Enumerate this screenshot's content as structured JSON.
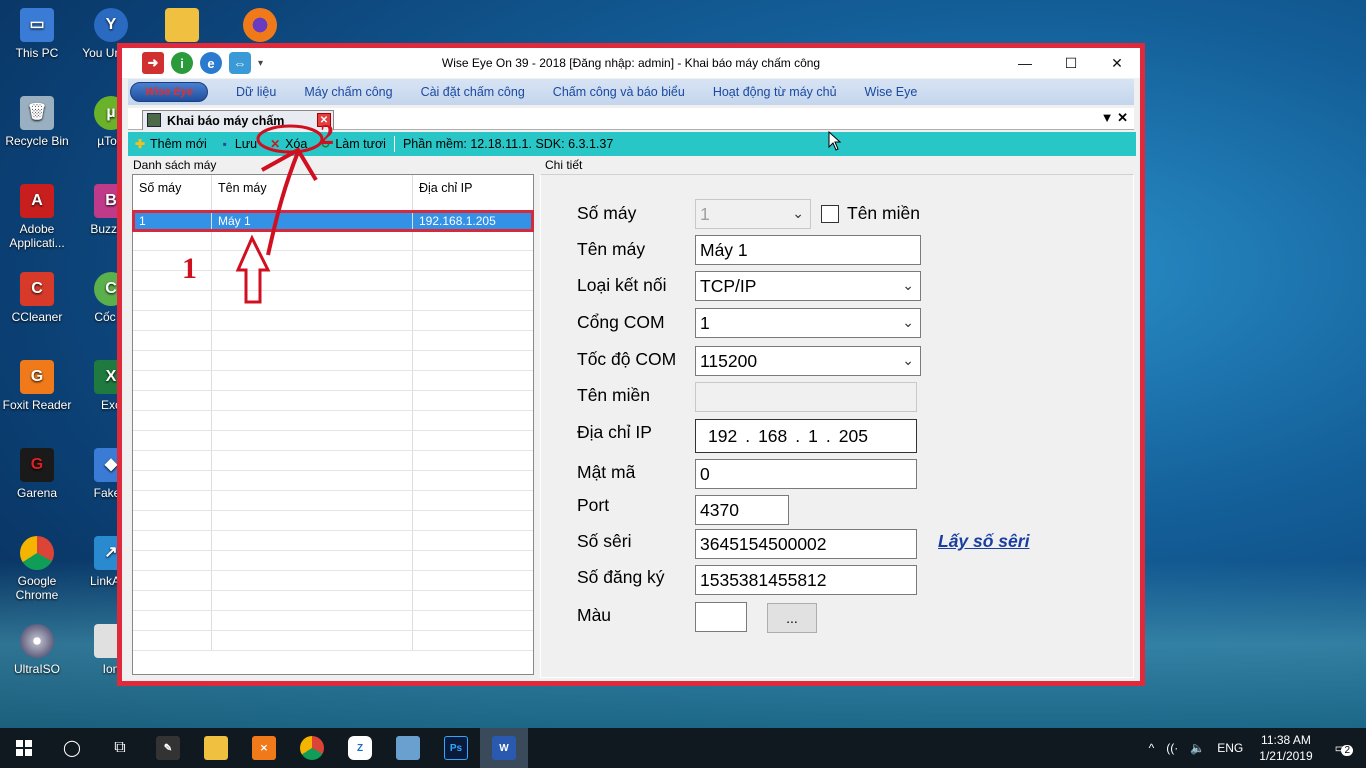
{
  "desktop": {
    "icons_left": [
      {
        "label": "This PC"
      },
      {
        "label": "Recycle Bin"
      },
      {
        "label": "Adobe Applicati..."
      },
      {
        "label": "CCleaner"
      },
      {
        "label": "Foxit Reader"
      },
      {
        "label": "Garena"
      },
      {
        "label": "Google Chrome"
      },
      {
        "label": "UltraISO"
      }
    ],
    "icons_second": [
      {
        "label": "You Uninst"
      },
      {
        "label": "µTorr"
      },
      {
        "label": "BuzzBu"
      },
      {
        "label": "Cốc C"
      },
      {
        "label": "Exc"
      },
      {
        "label": "FakeA"
      },
      {
        "label": "LinkAss"
      },
      {
        "label": "Ion"
      }
    ]
  },
  "window": {
    "title": "Wise Eye On 39 - 2018 [Đăng nhập: admin] - Khai báo máy chấm công",
    "logo_text": "Wise Eye",
    "menu": [
      "Dữ liệu",
      "Máy chấm công",
      "Cài đặt chấm công",
      "Chấm công và báo biểu",
      "Hoạt động từ máy chủ",
      "Wise Eye"
    ],
    "doc_tab": "Khai báo máy chấm",
    "toolbar": {
      "add": "Thêm mới",
      "save": "Lưu",
      "delete": "Xóa",
      "refresh": "Làm tươi",
      "info": "Phần mềm: 12.18.11.1. SDK: 6.3.1.37"
    },
    "list": {
      "title": "Danh sách máy",
      "headers": [
        "Số máy",
        "Tên máy",
        "Địa chỉ IP"
      ],
      "rows": [
        {
          "so_may": "1",
          "ten_may": "Máy 1",
          "ip": "192.168.1.205"
        }
      ]
    },
    "detail": {
      "title": "Chi tiết",
      "so_may_label": "Số máy",
      "so_may_value": "1",
      "ten_mien_check_label": "Tên miền",
      "ten_may_label": "Tên máy",
      "ten_may_value": "Máy 1",
      "loai_ket_noi_label": "Loại kết nối",
      "loai_ket_noi_value": "TCP/IP",
      "cong_com_label": "Cổng COM",
      "cong_com_value": "1",
      "toc_do_label": "Tốc độ COM",
      "toc_do_value": "115200",
      "ten_mien_label": "Tên miền",
      "ten_mien_value": "",
      "ip_label": "Địa chỉ IP",
      "ip_parts": [
        "192",
        "168",
        "1",
        "205"
      ],
      "mat_ma_label": "Mật mã",
      "mat_ma_value": "0",
      "port_label": "Port",
      "port_value": "4370",
      "so_seri_label": "Số sêri",
      "so_seri_value": "3645154500002",
      "lay_so_seri": "Lấy số sêri",
      "so_dang_ky_label": "Số đăng ký",
      "so_dang_ky_value": "1535381455812",
      "mau_label": "Màu",
      "mau_button": "..."
    }
  },
  "annotations": {
    "step1": "1",
    "step2": "2"
  },
  "taskbar": {
    "language": "ENG",
    "time": "11:38 AM",
    "date": "1/21/2019",
    "notifications": "2"
  },
  "colors": {
    "window_border": "#e0293b",
    "toolbar": "#28c6c6",
    "selection": "#3391e6",
    "annotation": "#d01020"
  }
}
